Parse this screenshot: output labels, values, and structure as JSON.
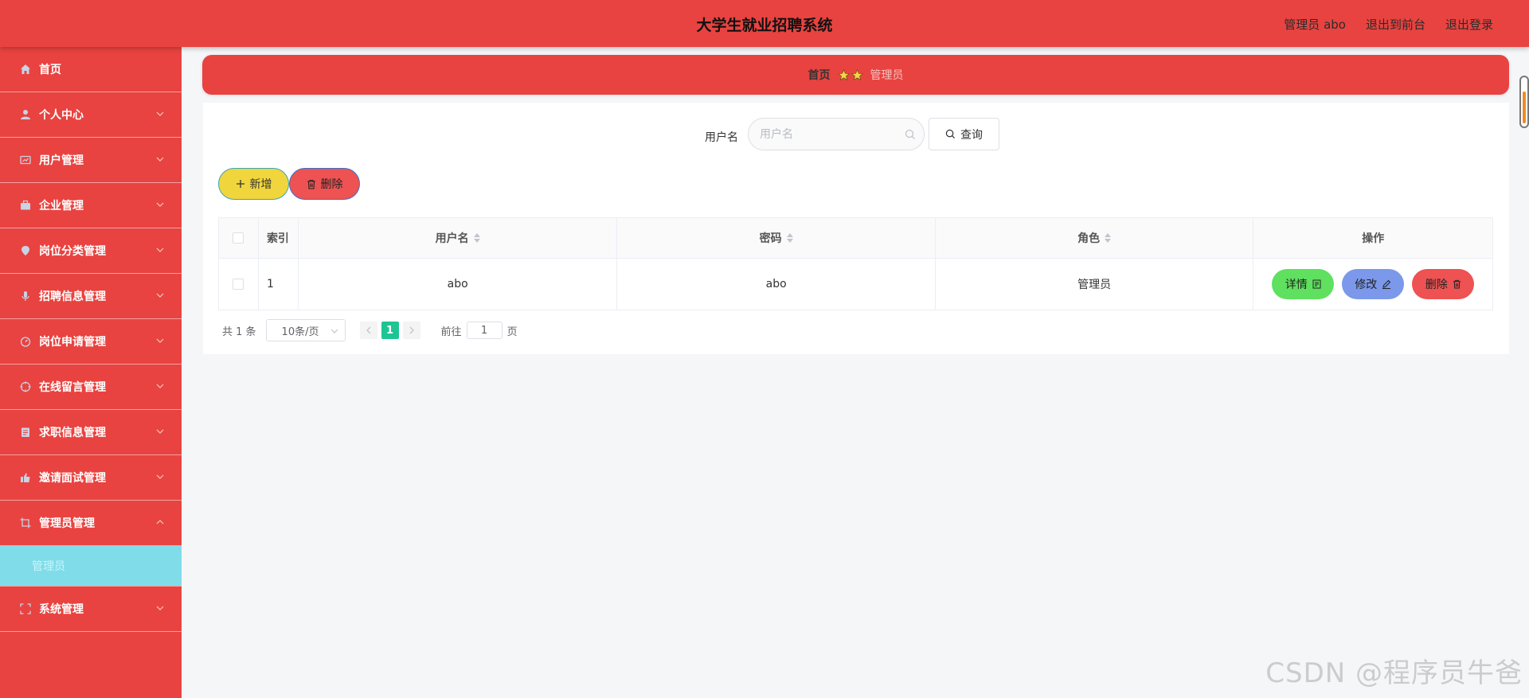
{
  "header": {
    "title": "大学生就业招聘系统",
    "user_label": "管理员 abo",
    "front_link": "退出到前台",
    "logout_link": "退出登录"
  },
  "sidebar": {
    "items": [
      {
        "label": "首页",
        "icon": "home-icon"
      },
      {
        "label": "个人中心",
        "icon": "user-icon"
      },
      {
        "label": "用户管理",
        "icon": "user-card-icon"
      },
      {
        "label": "企业管理",
        "icon": "briefcase-icon"
      },
      {
        "label": "岗位分类管理",
        "icon": "location-icon"
      },
      {
        "label": "招聘信息管理",
        "icon": "microphone-icon"
      },
      {
        "label": "岗位申请管理",
        "icon": "stopwatch-icon"
      },
      {
        "label": "在线留言管理",
        "icon": "aim-icon"
      },
      {
        "label": "求职信息管理",
        "icon": "document-icon"
      },
      {
        "label": "邀请面试管理",
        "icon": "thumb-icon"
      },
      {
        "label": "管理员管理",
        "icon": "crop-icon"
      },
      {
        "label": "系统管理",
        "icon": "full-screen-icon"
      }
    ],
    "submenu": {
      "label": "管理员"
    }
  },
  "breadcrumb": {
    "home": "首页",
    "current": "管理员"
  },
  "search": {
    "label": "用户名",
    "placeholder": "用户名",
    "query_label": "查询"
  },
  "actions": {
    "add_label": "新增",
    "delete_label": "删除"
  },
  "table": {
    "headers": {
      "index": "索引",
      "username": "用户名",
      "password": "密码",
      "role": "角色",
      "ops": "操作"
    },
    "rows": [
      {
        "index": "1",
        "username": "abo",
        "password": "abo",
        "role": "管理员"
      }
    ],
    "row_actions": {
      "detail": "详情",
      "edit": "修改",
      "delete": "删除"
    }
  },
  "pagination": {
    "total": "共 1 条",
    "page_size": "10条/页",
    "current_page": "1",
    "goto_label": "前往",
    "goto_value": "1",
    "page_suffix": "页"
  },
  "watermark": "CSDN @程序员牛爸",
  "colors": {
    "primary": "#e84340",
    "submenu": "#80dce9",
    "add": "#f0d63c",
    "delete": "#ee5252",
    "detail": "#5fe05f",
    "edit": "#7b98ea",
    "page_active": "#1ec594"
  }
}
